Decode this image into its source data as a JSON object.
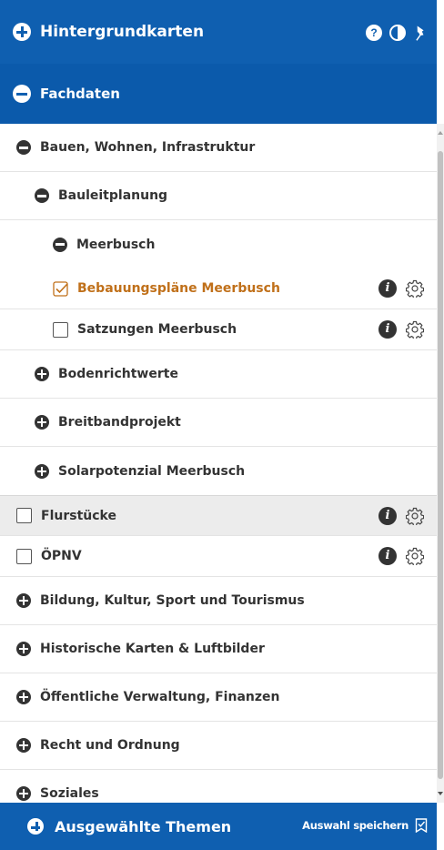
{
  "header": {
    "hintergrund_label": "Hintergrundkarten",
    "fach_label": "Fachdaten",
    "help_glyph": "?"
  },
  "tree": {
    "bauen": "Bauen, Wohnen, Infrastruktur",
    "bauleit": "Bauleitplanung",
    "meerbusch": "Meerbusch",
    "bebauung": "Bebauungspläne Meerbusch",
    "satzungen": "Satzungen Meerbusch",
    "boden": "Bodenrichtwerte",
    "breitband": "Breitbandprojekt",
    "solar": "Solarpotenzial Meerbusch",
    "flurstuecke": "Flurstücke",
    "oepnv": "ÖPNV",
    "bildung": "Bildung, Kultur, Sport und Tourismus",
    "historisch": "Historische Karten & Luftbilder",
    "verwaltung": "Öffentliche Verwaltung, Finanzen",
    "recht": "Recht und Ordnung",
    "soziales": "Soziales"
  },
  "info_glyph": "i",
  "footer": {
    "title": "Ausgewählte Themen",
    "save_label": "Auswahl speichern"
  },
  "colors": {
    "brand_blue": "#0f5fb0",
    "active_orange": "#c0701a",
    "selected_row_bg": "#ececec"
  }
}
